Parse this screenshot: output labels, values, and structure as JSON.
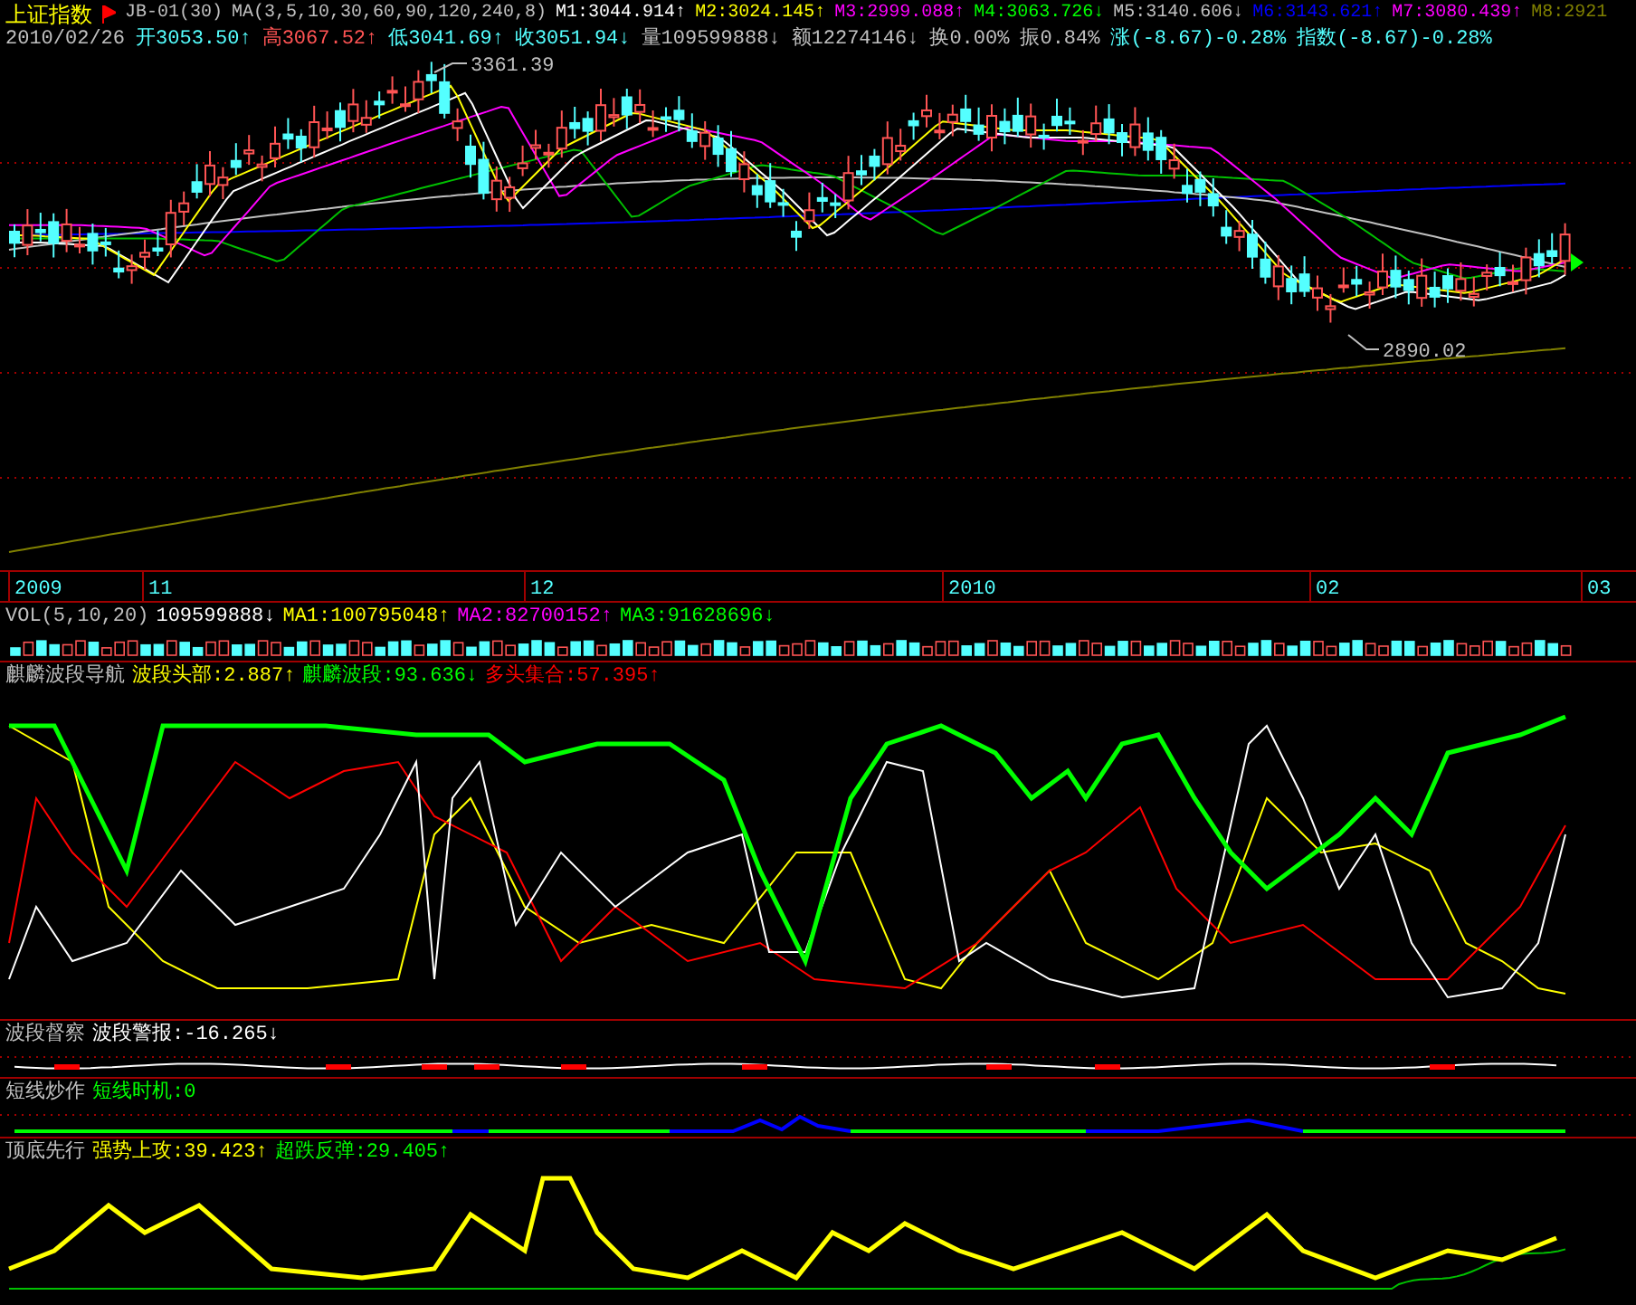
{
  "header": {
    "title": "上证指数",
    "formula": "JB-01(30)",
    "ma_label": "MA(3,5,10,30,60,90,120,240,8)",
    "mas": [
      {
        "label": "M1:3044.914↑",
        "color": "#ffffff"
      },
      {
        "label": "M2:3024.145↑",
        "color": "#ffff00"
      },
      {
        "label": "M3:2999.088↑",
        "color": "#ff00ff"
      },
      {
        "label": "M4:3063.726↓",
        "color": "#00ff00"
      },
      {
        "label": "M5:3140.606↓",
        "color": "#c0c0c0"
      },
      {
        "label": "M6:3143.621↑",
        "color": "#0000ff"
      },
      {
        "label": "M7:3080.439↑",
        "color": "#ff00ff"
      },
      {
        "label": "M8:2921",
        "color": "#808000"
      }
    ]
  },
  "quote": {
    "date": "2010/02/26",
    "items": [
      {
        "label": "开3053.50↑",
        "color": "#54ffff"
      },
      {
        "label": "高3067.52↑",
        "color": "#ff5454"
      },
      {
        "label": "低3041.69↑",
        "color": "#54ffff"
      },
      {
        "label": "收3051.94↓",
        "color": "#54ffff"
      },
      {
        "label": "量109599888↓",
        "color": "#c0c0c0"
      },
      {
        "label": "额12274146↓",
        "color": "#c0c0c0"
      },
      {
        "label": "换0.00%",
        "color": "#c0c0c0"
      },
      {
        "label": "振0.84%",
        "color": "#c0c0c0"
      },
      {
        "label": "涨(-8.67)-0.28%",
        "color": "#54ffff"
      },
      {
        "label": "指数(-8.67)-0.28%",
        "color": "#54ffff"
      }
    ]
  },
  "price_chart": {
    "high_label": "3361.39",
    "low_label": "2890.02"
  },
  "time_axis": [
    "2009",
    "11",
    "12",
    "2010",
    "02",
    "03"
  ],
  "volume": {
    "title": "VOL(5,10,20)",
    "items": [
      {
        "label": "109599888↓",
        "color": "#ffffff"
      },
      {
        "label": "MA1:100795048↑",
        "color": "#ffff00"
      },
      {
        "label": "MA2:82700152↑",
        "color": "#ff00ff"
      },
      {
        "label": "MA3:91628696↓",
        "color": "#00ff00"
      }
    ]
  },
  "panels": [
    {
      "title": "麒麟波段导航",
      "items": [
        {
          "label": "波段头部:2.887↑",
          "color": "#ffff00"
        },
        {
          "label": "麒麟波段:93.636↓",
          "color": "#00ff00"
        },
        {
          "label": "多头集合:57.395↑",
          "color": "#ff0000"
        }
      ]
    },
    {
      "title": "波段督察",
      "items": [
        {
          "label": "波段警报:-16.265↓",
          "color": "#ffffff"
        }
      ]
    },
    {
      "title": "短线炒作",
      "items": [
        {
          "label": "短线时机:0",
          "color": "#00ff00"
        }
      ]
    },
    {
      "title": "顶底先行",
      "items": [
        {
          "label": "强势上攻:39.423↑",
          "color": "#ffff00"
        },
        {
          "label": "超跌反弹:29.405↑",
          "color": "#00ff00"
        }
      ]
    }
  ]
}
